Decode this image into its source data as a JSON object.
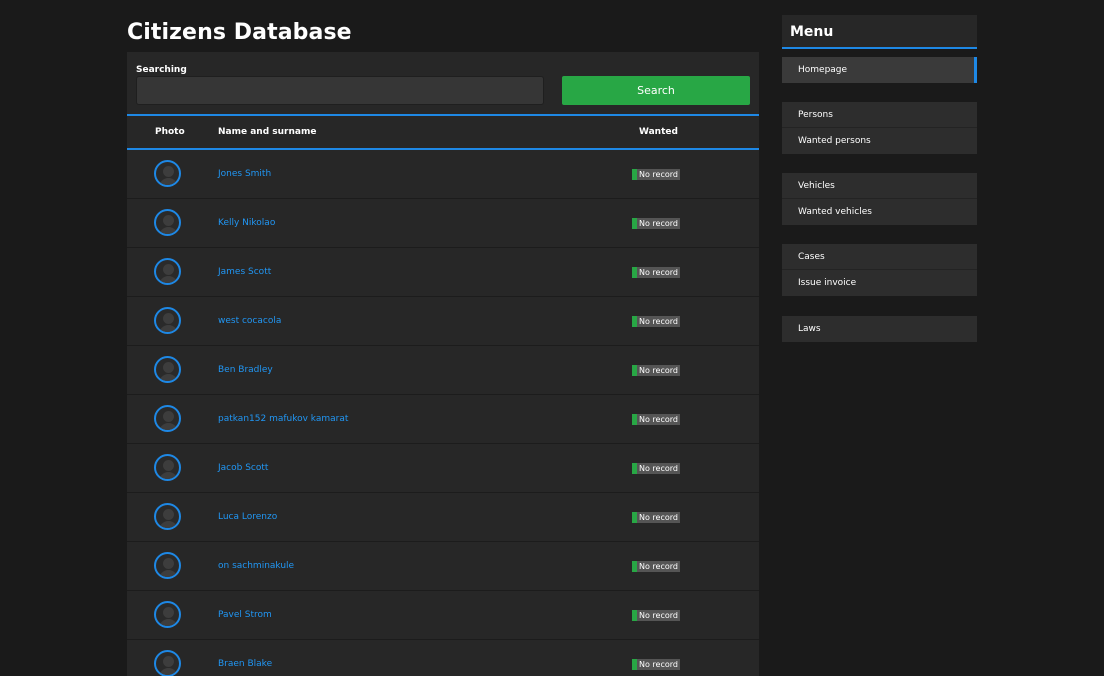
{
  "page": {
    "title": "Citizens Database"
  },
  "search": {
    "label": "Searching",
    "value": "",
    "placeholder": "",
    "button_label": "Search"
  },
  "table": {
    "columns": {
      "photo": "Photo",
      "name": "Name and surname",
      "wanted": "Wanted"
    },
    "rows": [
      {
        "name": "Jones Smith",
        "wanted": "No record"
      },
      {
        "name": "Kelly Nikolao",
        "wanted": "No record"
      },
      {
        "name": "James Scott",
        "wanted": "No record"
      },
      {
        "name": "west cocacola",
        "wanted": "No record"
      },
      {
        "name": "Ben Bradley",
        "wanted": "No record"
      },
      {
        "name": "patkan152 mafukov kamarat",
        "wanted": "No record"
      },
      {
        "name": "Jacob Scott",
        "wanted": "No record"
      },
      {
        "name": "Luca Lorenzo",
        "wanted": "No record"
      },
      {
        "name": "on sachminakule",
        "wanted": "No record"
      },
      {
        "name": "Pavel Strom",
        "wanted": "No record"
      },
      {
        "name": "Braen Blake",
        "wanted": "No record"
      }
    ]
  },
  "menu": {
    "title": "Menu",
    "groups": [
      {
        "items": [
          {
            "label": "Homepage",
            "active": true
          }
        ]
      },
      {
        "items": [
          {
            "label": "Persons"
          },
          {
            "label": "Wanted persons"
          }
        ]
      },
      {
        "items": [
          {
            "label": "Vehicles"
          },
          {
            "label": "Wanted vehicles"
          }
        ]
      },
      {
        "items": [
          {
            "label": "Cases"
          },
          {
            "label": "Issue invoice"
          }
        ]
      },
      {
        "items": [
          {
            "label": "Laws"
          }
        ]
      }
    ]
  },
  "colors": {
    "background": "#1a1a1a",
    "panel": "#272727",
    "accent": "#1e88e5",
    "link": "#2196f3",
    "success": "#28a745",
    "badge": "#555555"
  }
}
